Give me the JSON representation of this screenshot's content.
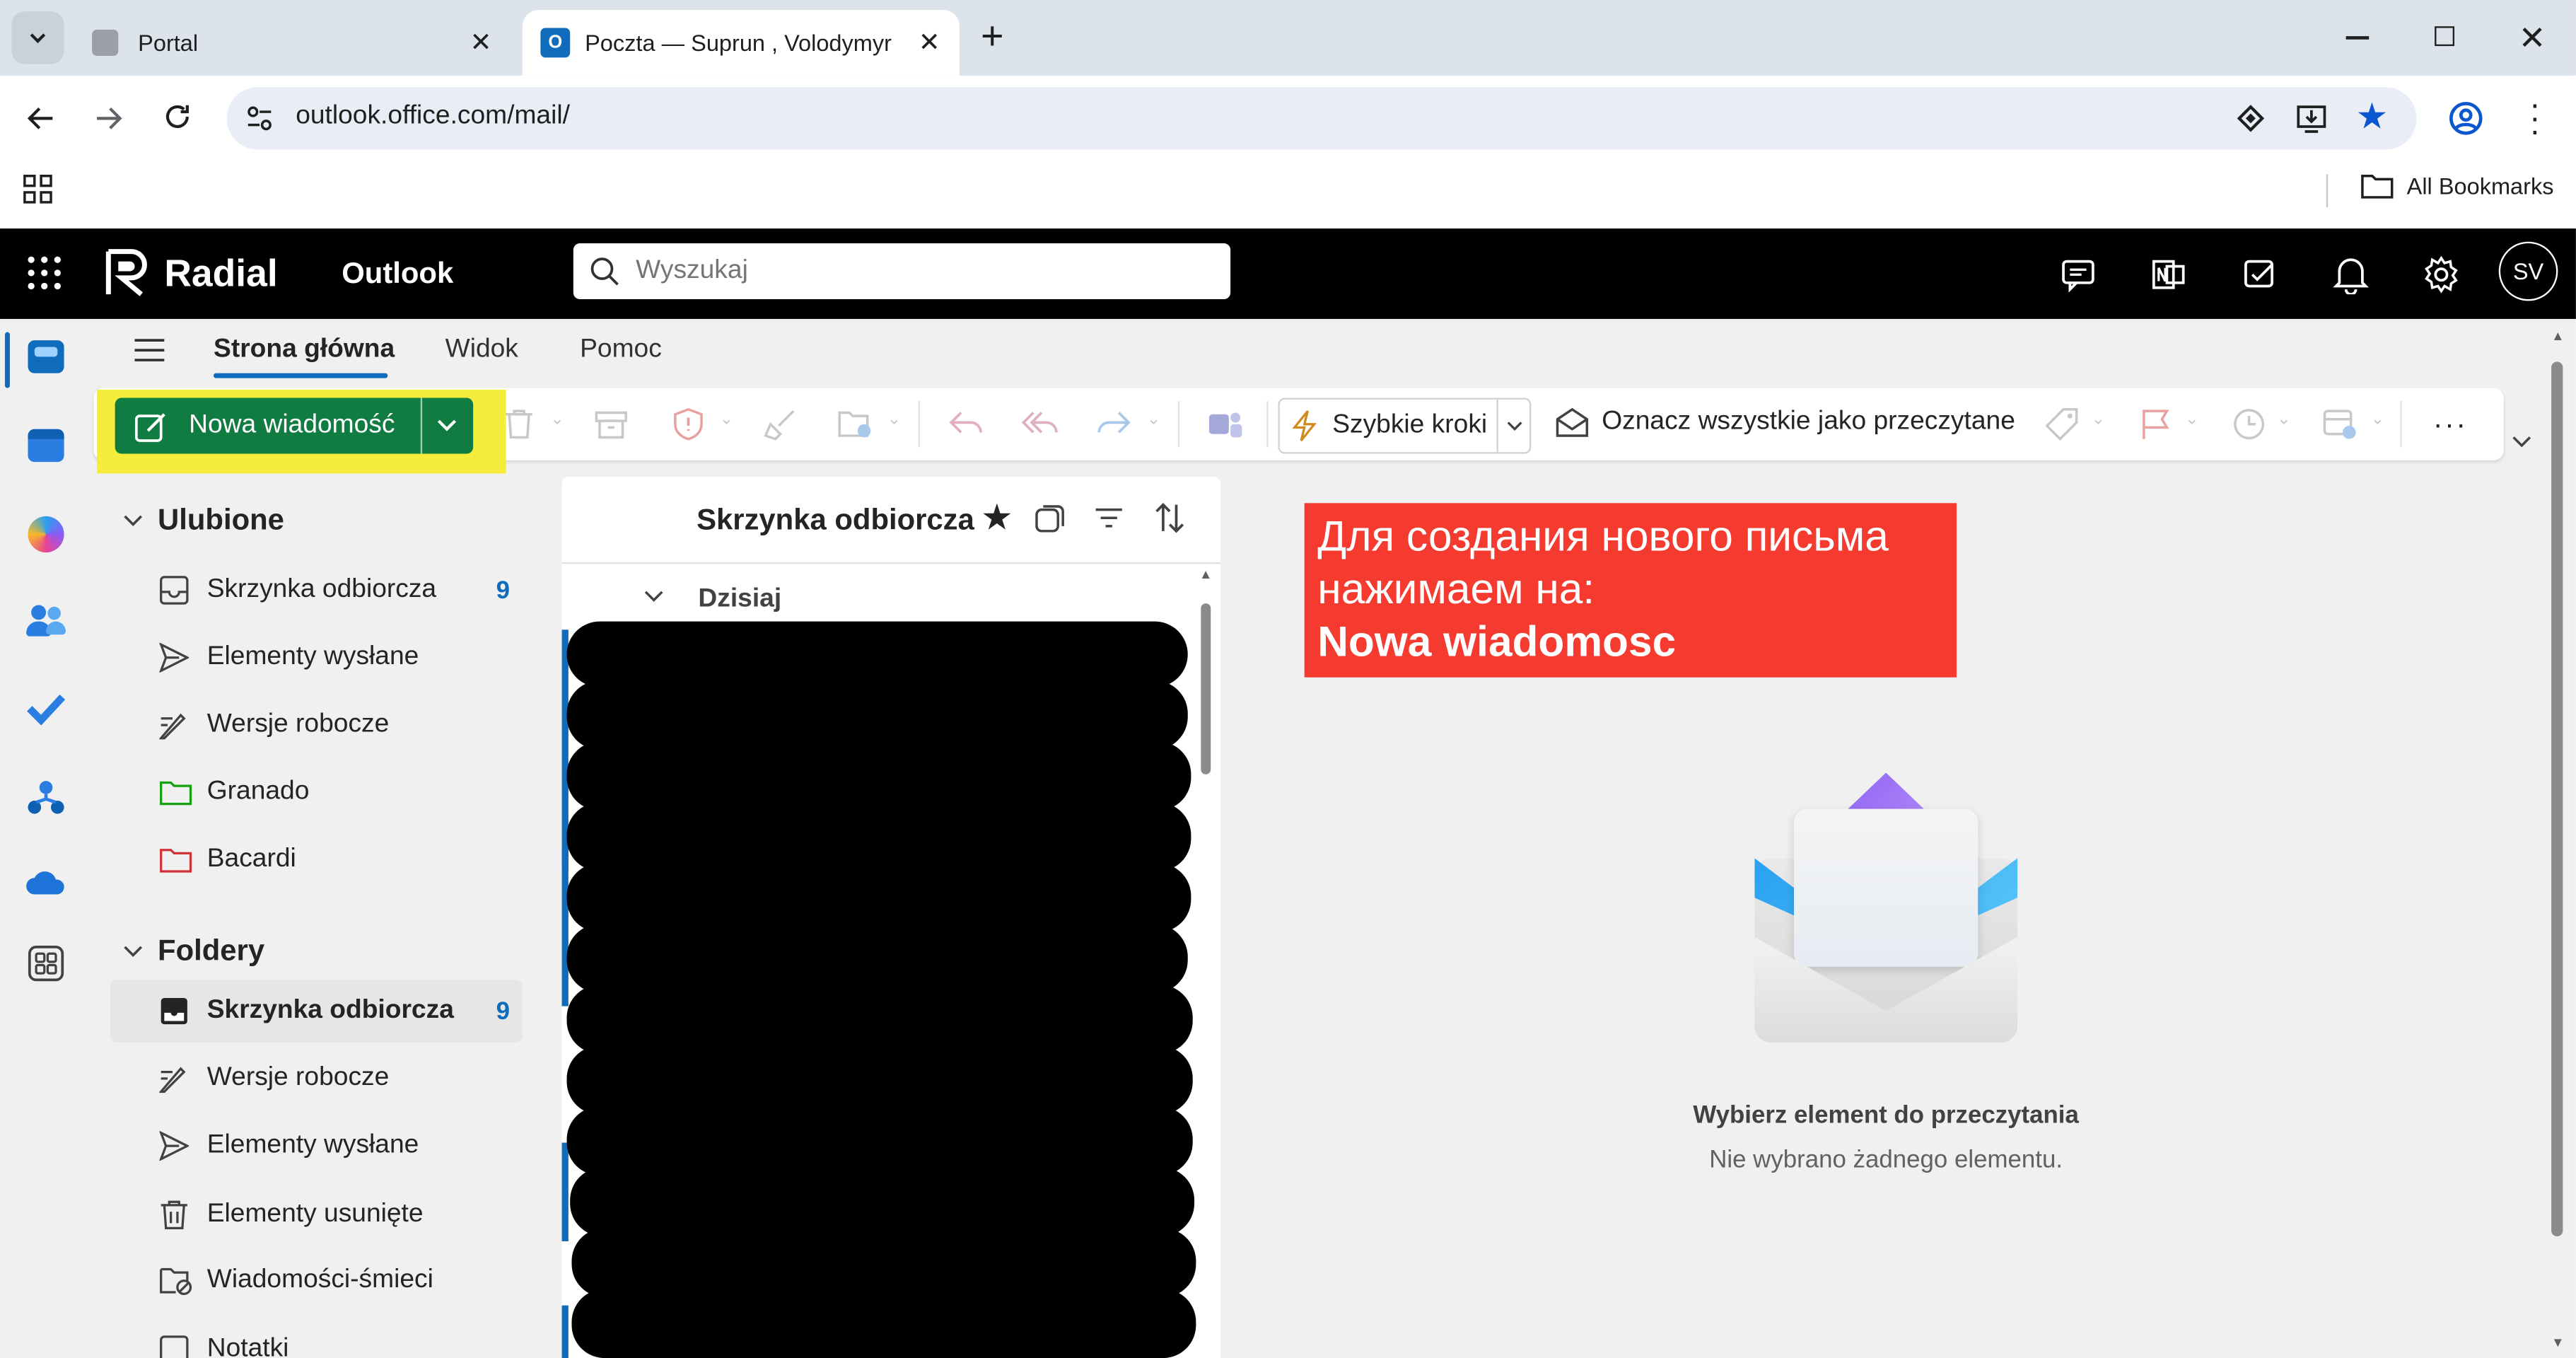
{
  "browser": {
    "tabs": [
      {
        "title": "Portal",
        "active": false
      },
      {
        "title": "Poczta — Suprun , Volodymyr – ",
        "active": true
      }
    ],
    "url": "outlook.office.com/mail/",
    "bookmarks_label": "All Bookmarks"
  },
  "header": {
    "brand": "Radial",
    "app_name": "Outlook",
    "search_placeholder": "Wyszukaj",
    "avatar_initials": "SV"
  },
  "nav_tabs": [
    "Strona główna",
    "Widok",
    "Pomoc"
  ],
  "ribbon": {
    "new_mail_label": "Nowa wiadomość",
    "quick_steps_label": "Szybkie kroki",
    "mark_all_read_label": "Oznacz wszystkie jako przeczytane",
    "accent_color": "#107c41",
    "highlight_color": "#f5ec3b"
  },
  "sidebar": {
    "favorites_label": "Ulubione",
    "favorites": [
      {
        "label": "Skrzynka odbiorcza",
        "count": "9",
        "icon": "inbox-icon"
      },
      {
        "label": "Elementy wysłane",
        "count": "",
        "icon": "send-icon"
      },
      {
        "label": "Wersje robocze",
        "count": "",
        "icon": "draft-icon"
      },
      {
        "label": "Granado",
        "count": "",
        "icon": "folder-green-icon"
      },
      {
        "label": "Bacardi",
        "count": "",
        "icon": "folder-red-icon"
      }
    ],
    "folders_label": "Foldery",
    "folders": [
      {
        "label": "Skrzynka odbiorcza",
        "count": "9",
        "icon": "inbox-icon",
        "selected": true
      },
      {
        "label": "Wersje robocze",
        "count": "",
        "icon": "draft-icon"
      },
      {
        "label": "Elementy wysłane",
        "count": "",
        "icon": "send-icon"
      },
      {
        "label": "Elementy usunięte",
        "count": "",
        "icon": "trash-icon"
      },
      {
        "label": "Wiadomości-śmieci",
        "count": "",
        "icon": "junk-icon"
      },
      {
        "label": "Notatki",
        "count": "",
        "icon": "notes-icon"
      }
    ]
  },
  "message_list": {
    "title": "Skrzynka odbiorcza",
    "group_label": "Dzisiaj"
  },
  "reading_pane": {
    "empty_title": "Wybierz element do przeczytania",
    "empty_subtitle": "Nie wybrano żadnego elementu."
  },
  "callout": {
    "line1": "Для создания нового письма",
    "line2": "нажимаем на:",
    "line3": "Nowa wiadomosc",
    "color": "#f53a2f"
  }
}
